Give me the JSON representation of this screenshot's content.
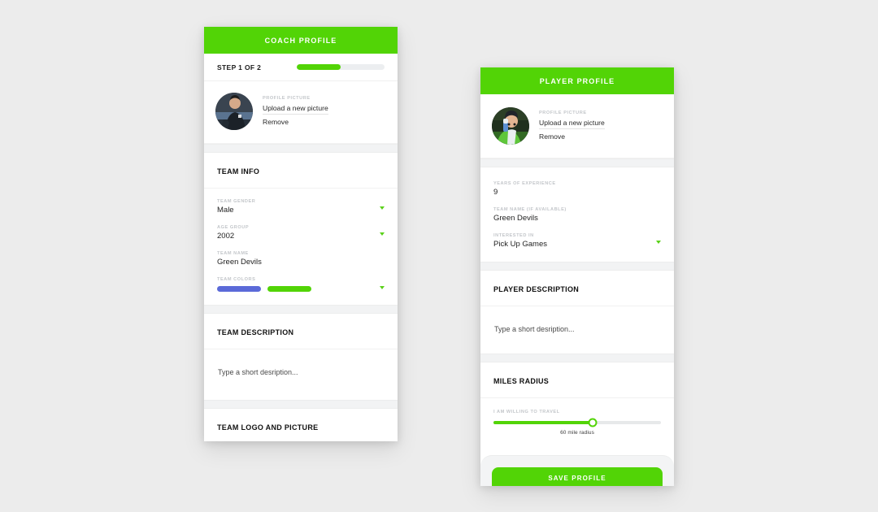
{
  "background_color": "#ececec",
  "accent_color": "#52d406",
  "coach_card": {
    "title": "COACH PROFILE",
    "step": {
      "label": "STEP 1 OF 2",
      "progress_percent": 50
    },
    "profile_picture": {
      "label": "PROFILE PICTURE",
      "upload_link": "Upload a new picture",
      "remove_link": "Remove",
      "avatar_name": "coach-avatar"
    },
    "sections": [
      {
        "title": "TEAM INFO",
        "fields": [
          {
            "label": "TEAM GENDER",
            "value": "Male",
            "type": "select"
          },
          {
            "label": "AGE GROUP",
            "value": "2002",
            "type": "select"
          },
          {
            "label": "TEAM NAME",
            "value": "Green Devils",
            "type": "text"
          },
          {
            "label": "TEAM COLORS",
            "value": "",
            "type": "colors",
            "colors": [
              "#5b6ad8",
              "#52d406"
            ]
          }
        ]
      },
      {
        "title": "TEAM DESCRIPTION",
        "placeholder": "Type a short desription..."
      },
      {
        "title": "TEAM LOGO AND PICTURE"
      }
    ]
  },
  "player_card": {
    "title": "PLAYER PROFILE",
    "profile_picture": {
      "label": "PROFILE PICTURE",
      "upload_link": "Upload a new picture",
      "remove_link": "Remove",
      "avatar_name": "player-avatar"
    },
    "fields": [
      {
        "label": "YEARS OF EXPERIENCE",
        "value": "9",
        "type": "text"
      },
      {
        "label": "TEAM NAME (IF AVAILABLE)",
        "value": "Green Devils",
        "type": "text"
      },
      {
        "label": "INTERESTED IN",
        "value": "Pick Up Games",
        "type": "select"
      }
    ],
    "description_section": {
      "title": "PLAYER DESCRIPTION",
      "placeholder": "Type a short desription..."
    },
    "radius_section": {
      "title": "MILES RADIUS",
      "label": "I AM WILLING TO TRAVEL",
      "caption": "60 mile radius",
      "value_percent": 59
    },
    "save_button": "SAVE PROFILE"
  }
}
